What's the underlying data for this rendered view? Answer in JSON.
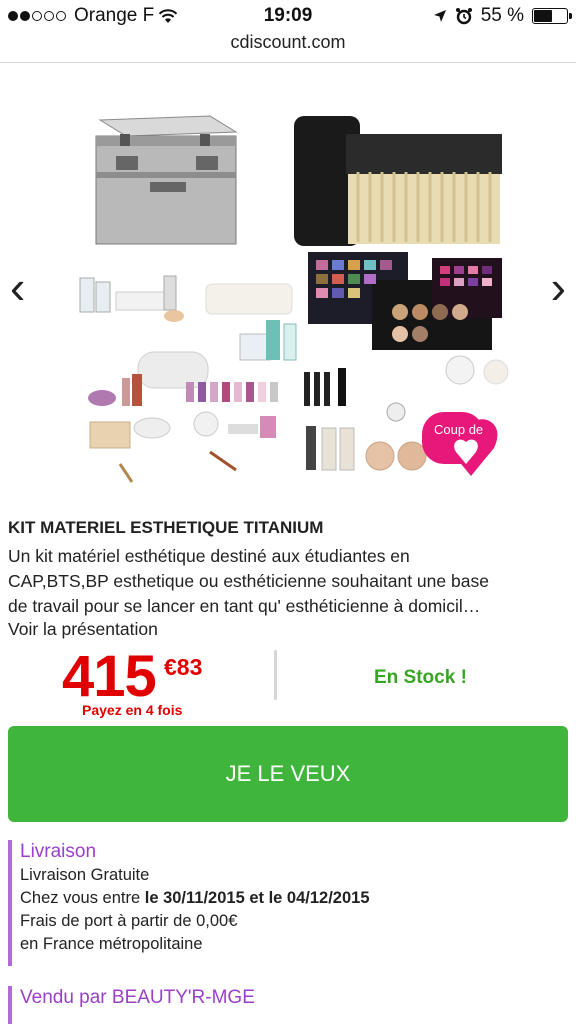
{
  "status_bar": {
    "carrier": "Orange F",
    "time": "19:09",
    "battery": "55 %",
    "battery_level": 0.55
  },
  "browser": {
    "url": "cdiscount.com"
  },
  "gallery": {
    "prev_icon": "chevron-left-icon",
    "next_icon": "chevron-right-icon",
    "badge_text": "Coup de"
  },
  "product": {
    "title": "KIT MATERIEL ESTHETIQUE TITANIUM",
    "description_lines": [
      "Un kit matériel esthétique destiné aux étudiantes en",
      "CAP,BTS,BP esthetique ou esthéticienne souhaitant une base",
      "de travail pour  se lancer en tant qu' esthéticienne à domicil…"
    ],
    "more_link": "Voir la présentation"
  },
  "price": {
    "integer": "415",
    "decimal": "€83",
    "installments": "Payez en 4 fois",
    "stock": "En Stock !"
  },
  "cta": {
    "label": "JE LE VEUX",
    "color": "#3fb53c"
  },
  "delivery": {
    "title": "Livraison",
    "free": "Livraison Gratuite",
    "dates_prefix": "Chez vous entre ",
    "dates": "le 30/11/2015 et le 04/12/2015",
    "shipping": "Frais de port à partir de 0,00€",
    "region": "en France métropolitaine"
  },
  "seller": {
    "label": "Vendu par BEAUTY'R-MGE"
  },
  "colors": {
    "price_red": "#e00000",
    "stock_green": "#39a525",
    "accent_purple": "#9a3fc9"
  }
}
